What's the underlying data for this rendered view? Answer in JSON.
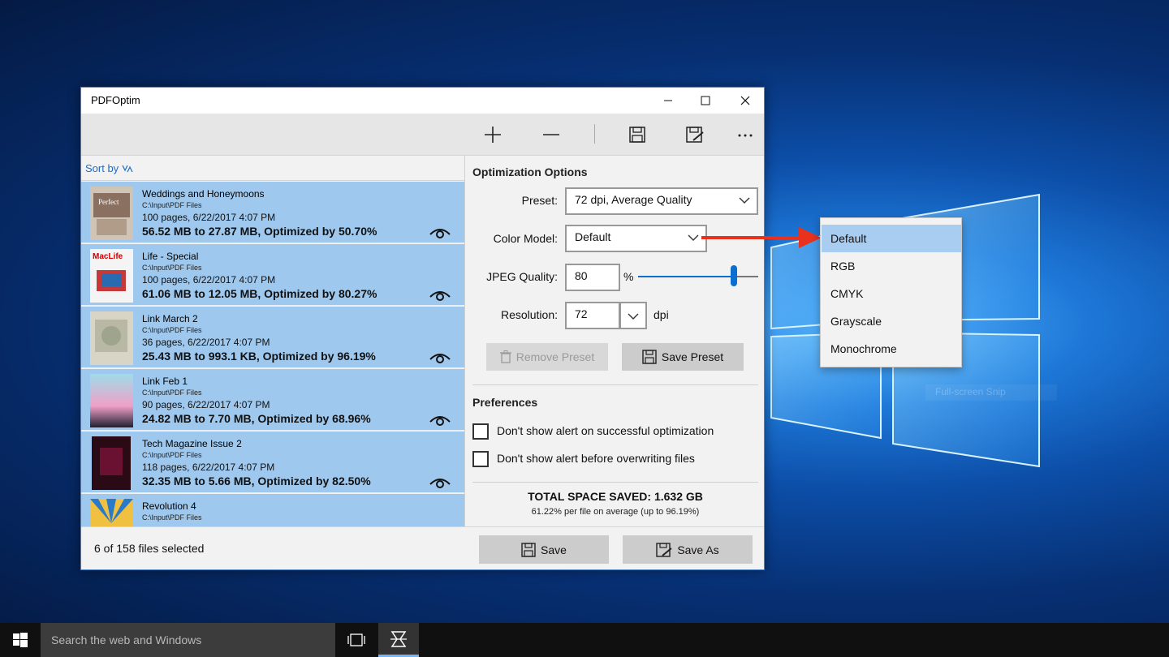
{
  "window": {
    "title": "PDFOptim"
  },
  "toolbar": {
    "add_icon": "plus-icon",
    "remove_icon": "minus-icon",
    "save_icon": "floppy-icon",
    "save_as_icon": "floppy-edit-icon",
    "more_icon": "ellipsis-icon"
  },
  "left_pane": {
    "sort_label": "Sort by",
    "files": [
      {
        "name": "Weddings and Honeymoons",
        "path": "C:\\Input\\PDF Files",
        "meta": "100 pages, 6/22/2017 4:07 PM",
        "result": "56.52 MB to 27.87 MB, Optimized by 50.70%"
      },
      {
        "name": "Life - Special",
        "path": "C:\\Input\\PDF Files",
        "meta": "100 pages, 6/22/2017 4:07 PM",
        "result": "61.06 MB to 12.05 MB, Optimized by 80.27%"
      },
      {
        "name": "Link March 2",
        "path": "C:\\Input\\PDF Files",
        "meta": "36 pages, 6/22/2017 4:07 PM",
        "result": "25.43 MB to 993.1 KB, Optimized by 96.19%"
      },
      {
        "name": "Link Feb 1",
        "path": "C:\\Input\\PDF Files",
        "meta": "90 pages, 6/22/2017 4:07 PM",
        "result": "24.82 MB to 7.70 MB, Optimized by 68.96%"
      },
      {
        "name": "Tech Magazine Issue 2",
        "path": "C:\\Input\\PDF Files",
        "meta": "118 pages, 6/22/2017 4:07 PM",
        "result": "32.35 MB to 5.66 MB, Optimized by 82.50%"
      },
      {
        "name": "Revolution 4",
        "path": "C:\\Input\\PDF Files",
        "meta": "",
        "result": ""
      }
    ]
  },
  "options": {
    "title": "Optimization Options",
    "preset_label": "Preset:",
    "preset_value": "72 dpi, Average Quality",
    "color_model_label": "Color Model:",
    "color_model_value": "Default",
    "jpeg_label": "JPEG Quality:",
    "jpeg_value": "80",
    "jpeg_unit": "%",
    "jpeg_slider_level": 0.8,
    "resolution_label": "Resolution:",
    "resolution_value": "72",
    "resolution_unit": "dpi",
    "remove_preset_label": "Remove Preset",
    "save_preset_label": "Save Preset"
  },
  "preferences": {
    "title": "Preferences",
    "pref1_label": "Don't show alert on successful optimization",
    "pref2_label": "Don't show alert before overwriting files"
  },
  "summary": {
    "total": "TOTAL SPACE SAVED: 1.632 GB",
    "average": "61.22% per file on average (up to 96.19%)"
  },
  "footer": {
    "status": "6 of 158 files selected",
    "save_label": "Save",
    "save_as_label": "Save As"
  },
  "dropdown": {
    "options": [
      "Default",
      "RGB",
      "CMYK",
      "Grayscale",
      "Monochrome"
    ],
    "selected": "Default"
  },
  "desktop": {
    "ghost_text": "Full-screen Snip"
  },
  "taskbar": {
    "search_placeholder": "Search the web and Windows"
  },
  "colors": {
    "accent": "#0c6fd0",
    "selection": "#9ec8ee",
    "arrow": "#e8321e"
  }
}
